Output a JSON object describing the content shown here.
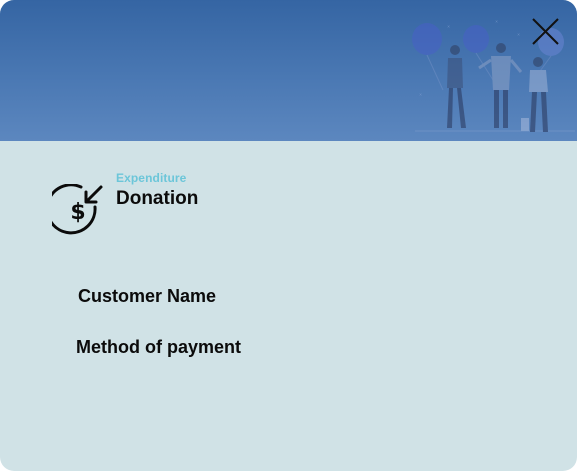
{
  "modal": {
    "close_icon": "close-icon",
    "banner_illustration": "people-with-balloons-illustration"
  },
  "transaction": {
    "category_icon": "money-incoming-icon",
    "category": "Expenditure",
    "title": "Donation"
  },
  "details": {
    "customer_label": "Customer Name",
    "payment_label": "Method of payment"
  },
  "colors": {
    "banner_top": "#3565a3",
    "banner_bottom": "#5c87bf",
    "body_background": "#d0e2e6",
    "category_accent": "#6cc6d9",
    "text": "#0b0b0b"
  }
}
